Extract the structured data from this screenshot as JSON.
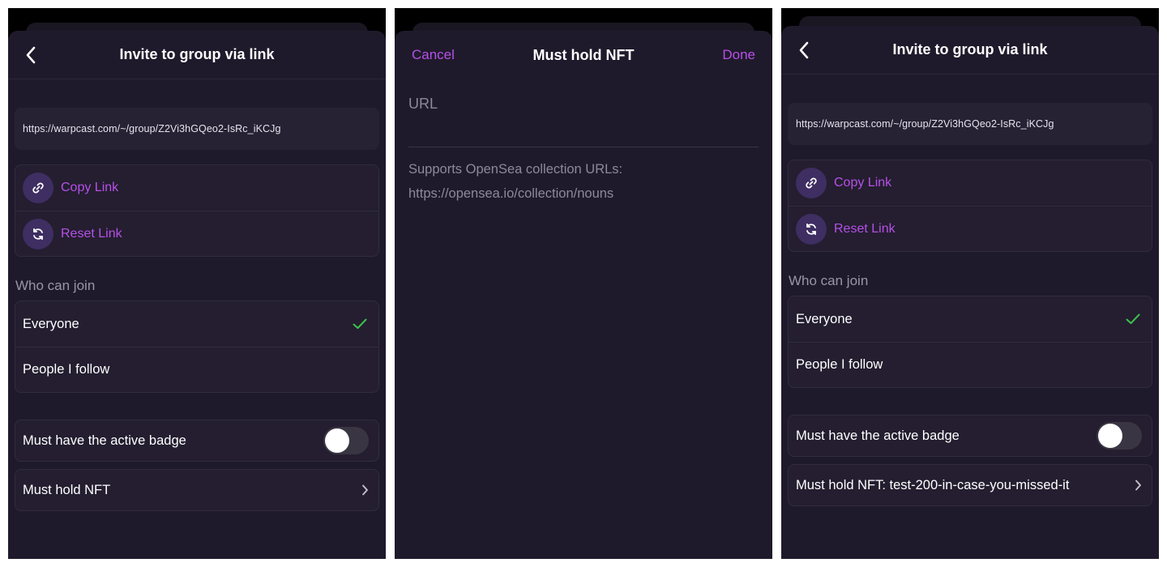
{
  "screen1": {
    "title": "Invite to group via link",
    "link": "https://warpcast.com/~/group/Z2Vi3hGQeo2-IsRc_iKCJg",
    "actions": [
      {
        "label": "Copy Link",
        "icon": "link-icon"
      },
      {
        "label": "Reset Link",
        "icon": "refresh-icon"
      }
    ],
    "who_can_join_label": "Who can join",
    "options": [
      {
        "label": "Everyone",
        "selected": true
      },
      {
        "label": "People I follow",
        "selected": false
      }
    ],
    "badge_label": "Must have the active badge",
    "badge_enabled": false,
    "nft_label": "Must hold NFT"
  },
  "screen2": {
    "cancel_label": "Cancel",
    "title": "Must hold NFT",
    "done_label": "Done",
    "url_placeholder": "URL",
    "hint_line1": "Supports OpenSea collection URLs:",
    "hint_line2": "https://opensea.io/collection/nouns"
  },
  "screen3": {
    "title": "Invite to group via link",
    "link": "https://warpcast.com/~/group/Z2Vi3hGQeo2-IsRc_iKCJg",
    "actions": [
      {
        "label": "Copy Link",
        "icon": "link-icon"
      },
      {
        "label": "Reset Link",
        "icon": "refresh-icon"
      }
    ],
    "who_can_join_label": "Who can join",
    "options": [
      {
        "label": "Everyone",
        "selected": true
      },
      {
        "label": "People I follow",
        "selected": false
      }
    ],
    "badge_label": "Must have the active badge",
    "badge_enabled": false,
    "nft_label": "Must hold NFT: test-200-in-case-you-missed-it"
  },
  "colors": {
    "accent": "#b650e8",
    "check": "#3cc24a",
    "background": "#1f1a2b"
  }
}
